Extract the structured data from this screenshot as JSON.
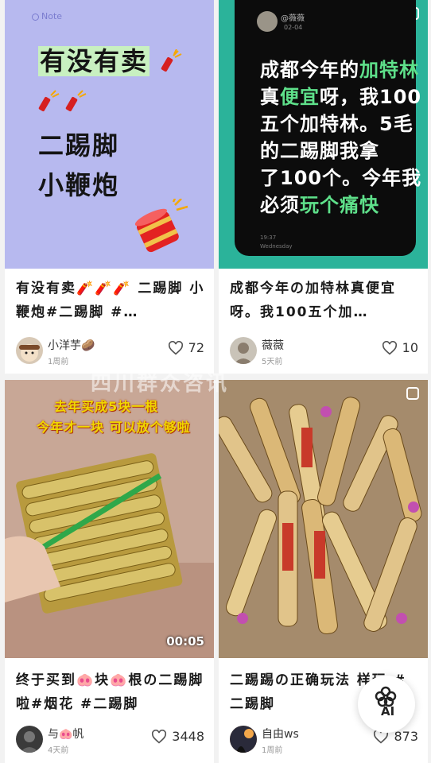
{
  "watermark": "四川群众咨讯",
  "ai_button": {
    "label": "AI"
  },
  "cards": [
    {
      "cover": {
        "note_label": "Note",
        "lines": [
          "有没有卖",
          "",
          "二踢脚",
          "小鞭炮"
        ]
      },
      "title": "有没有卖🧨🧨🧨 二踢脚 小鞭炮#二踢脚 #…",
      "author": "小洋芋🥔",
      "time": "1周前",
      "likes": "72"
    },
    {
      "cover": {
        "name": "@薇薇",
        "date": "02-04",
        "lines": [
          [
            "成都今年的",
            "加特林"
          ],
          [
            "真",
            "便宜",
            "呀，我100"
          ],
          [
            "五个加特林。5毛"
          ],
          [
            "的二踢脚我拿"
          ],
          [
            "了100个。今年我"
          ],
          [
            "必须",
            "玩个痛快"
          ]
        ],
        "foot_time": "19:37",
        "foot_day": "Wednesday"
      },
      "title": "成都今年の加特林真便宜呀。我100五个加…",
      "author": "薇薇",
      "time": "5天前",
      "likes": "10"
    },
    {
      "cover": {
        "caption1": "去年买成5块一根",
        "caption2": "今年才一块 可以放个够啦",
        "duration": "00:05"
      },
      "title": "终于买到🐽块🐽根の二踢脚啦#烟花 #二踢脚",
      "author": "与🐽帆",
      "time": "4天前",
      "likes": "3448"
    },
    {
      "cover": {},
      "title": "二踢踢の正确玩法 样玩 #二踢脚",
      "author": "自由ws",
      "time": "1周前",
      "likes": "873"
    }
  ],
  "colors": {
    "accent_green": "#5ee08a",
    "caption_yellow": "#f0d800"
  }
}
